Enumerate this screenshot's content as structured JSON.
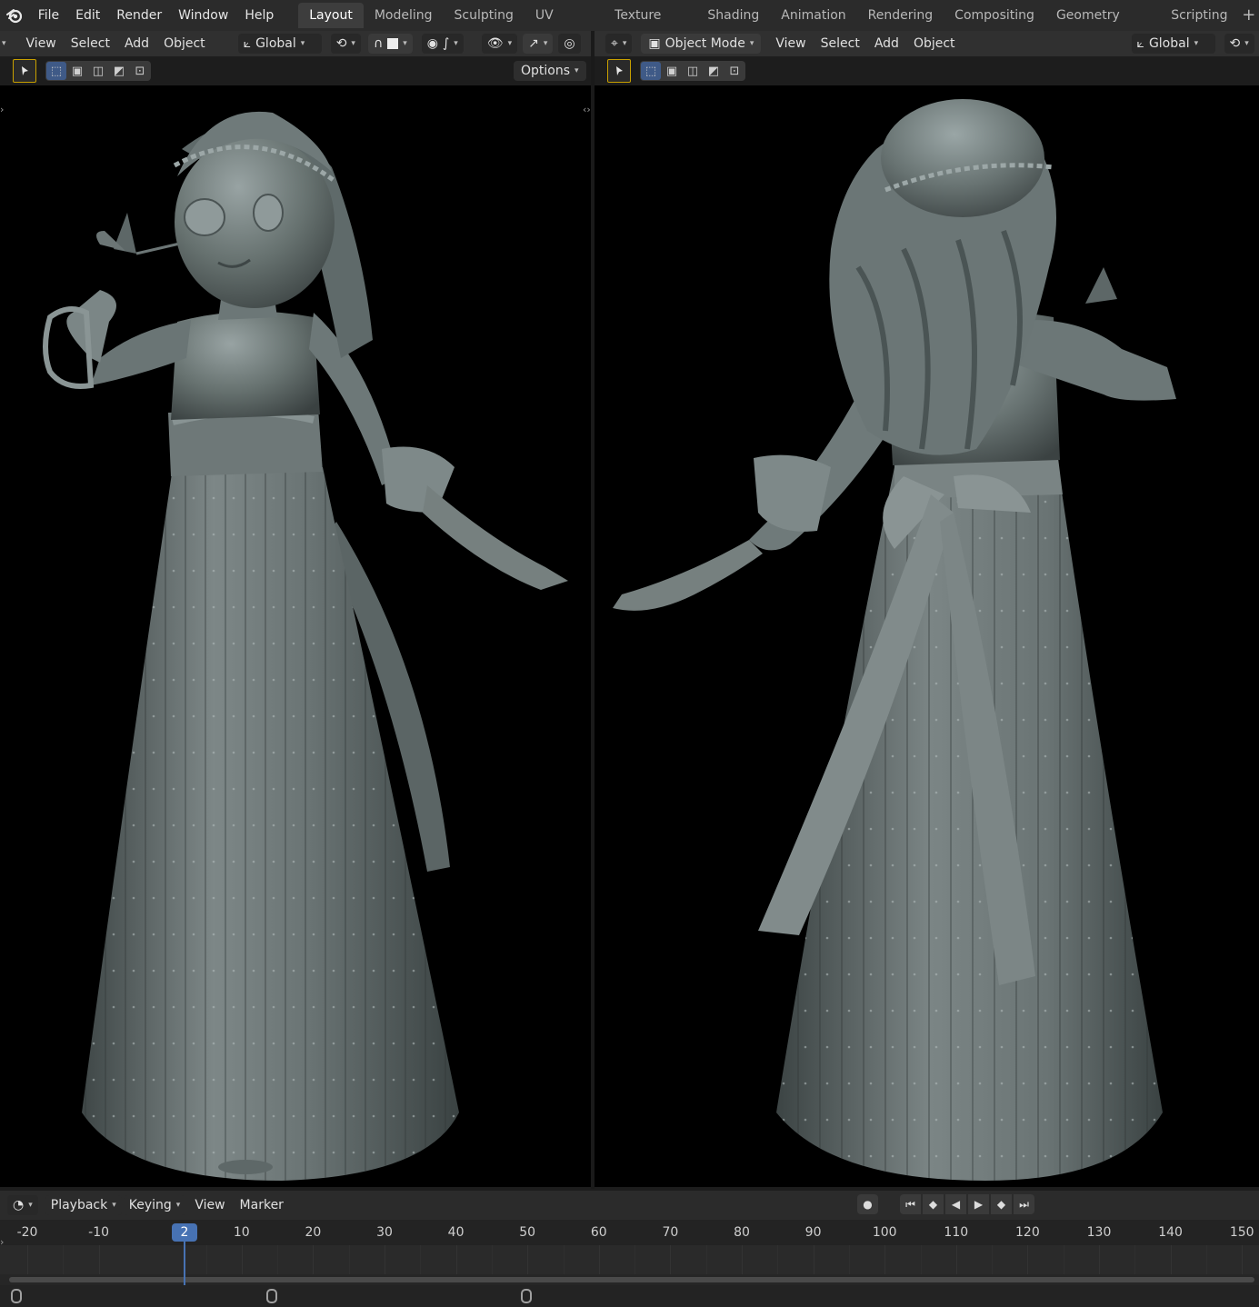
{
  "menubar": {
    "items": [
      "File",
      "Edit",
      "Render",
      "Window",
      "Help"
    ]
  },
  "workspaces": {
    "tabs": [
      "Layout",
      "Modeling",
      "Sculpting",
      "UV Editing",
      "Texture Paint",
      "Shading",
      "Animation",
      "Rendering",
      "Compositing",
      "Geometry Nodes",
      "Scripting"
    ],
    "active": "Layout",
    "add_label": "+"
  },
  "left_viewport": {
    "menu": [
      "View",
      "Select",
      "Add",
      "Object"
    ],
    "orientation": "Global",
    "options_label": "Options"
  },
  "right_viewport": {
    "mode": "Object Mode",
    "menu": [
      "View",
      "Select",
      "Add",
      "Object"
    ],
    "orientation": "Global"
  },
  "timeline": {
    "menu": [
      "Playback",
      "Keying",
      "View",
      "Marker"
    ],
    "current_frame": "2",
    "ticks": [
      "-20",
      "-10",
      "10",
      "20",
      "30",
      "40",
      "50",
      "60",
      "70",
      "80",
      "90",
      "100",
      "110",
      "120",
      "130",
      "140",
      "150"
    ],
    "tick_values": [
      -20,
      -10,
      10,
      20,
      30,
      40,
      50,
      60,
      70,
      80,
      90,
      100,
      110,
      120,
      130,
      140,
      150
    ]
  },
  "colors": {
    "accent": "#4772b3",
    "active_tool_border": "#c8a000",
    "sculpt_clay": "#6f7b7b"
  }
}
